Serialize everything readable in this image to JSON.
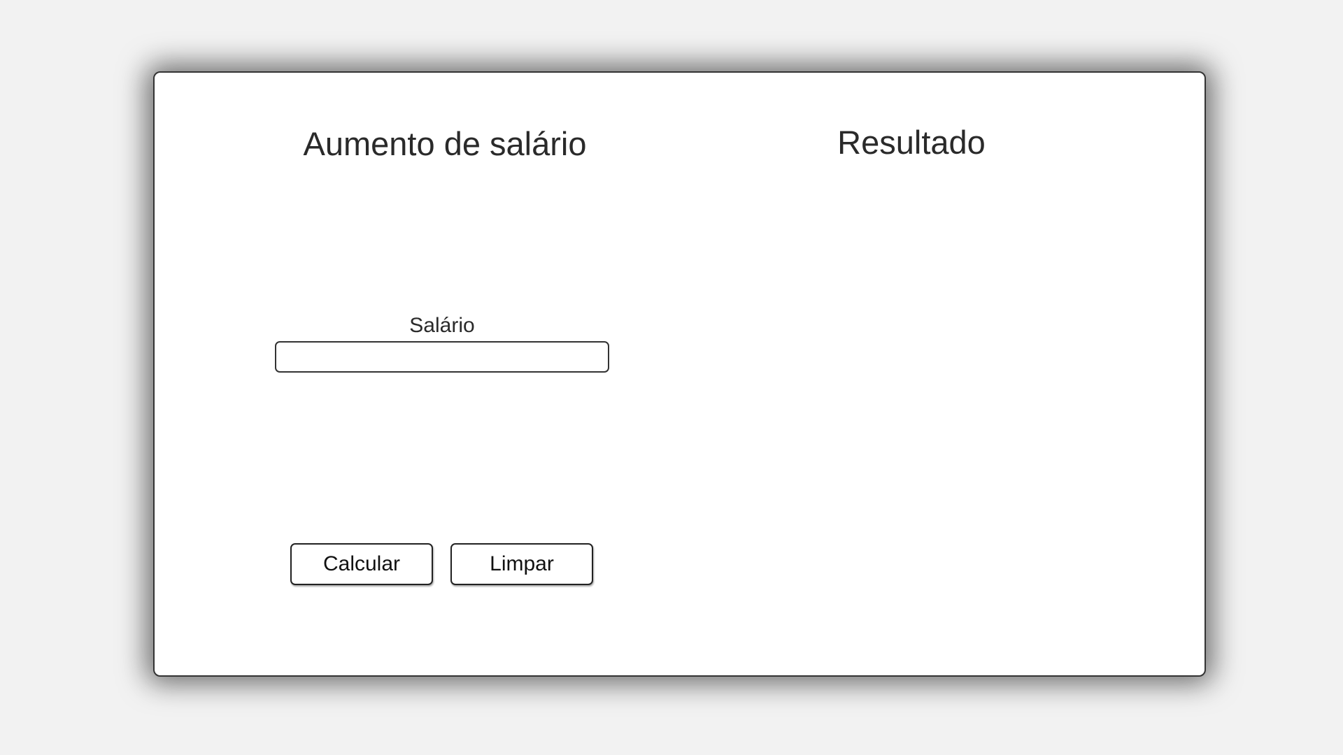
{
  "form": {
    "title": "Aumento de salário",
    "salary_label": "Salário",
    "salary_value": "",
    "salary_placeholder": "",
    "calculate_label": "Calcular",
    "clear_label": "Limpar"
  },
  "result": {
    "title": "Resultado",
    "content": ""
  },
  "colors": {
    "background": "#f2f2f2",
    "card": "#ffffff",
    "border": "#333333",
    "text": "#222222"
  }
}
